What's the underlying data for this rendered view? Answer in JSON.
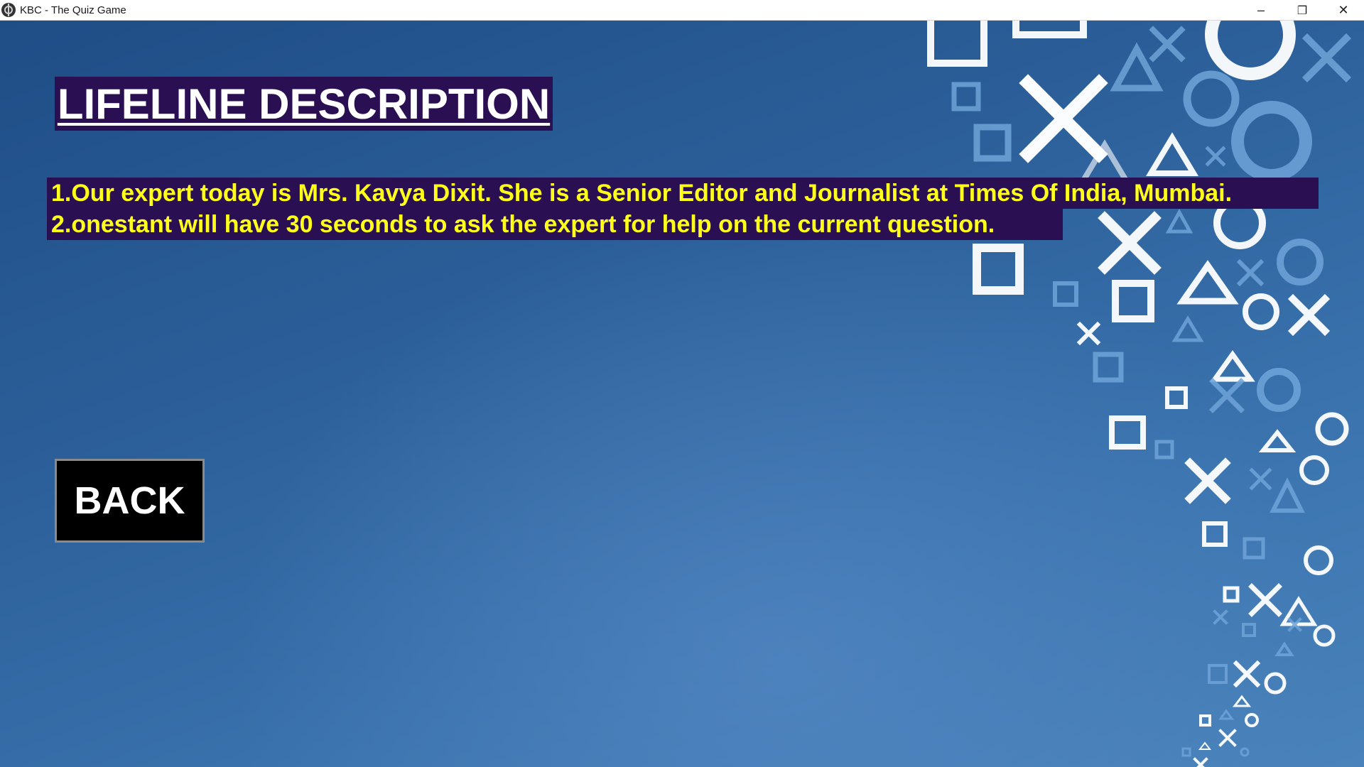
{
  "window": {
    "title": "KBC - The Quiz Game",
    "controls": {
      "minimize": "–",
      "restore": "❐",
      "close": "✕"
    }
  },
  "heading": {
    "text": "LIFELINE DESCRIPTION"
  },
  "description": {
    "lines": [
      "1.Our expert today is Mrs. Kavya Dixit. She is a Senior Editor and Journalist at Times Of India, Mumbai.",
      "2.onestant will have 30 seconds to ask the expert for help on the current question."
    ]
  },
  "back_button": {
    "label": "BACK"
  },
  "colors": {
    "heading_bg": "#2a0f52",
    "description_text": "#ffff1a",
    "background": "#2d5b92"
  },
  "icons": [
    "app-icon",
    "minimize-icon",
    "restore-icon",
    "close-icon"
  ]
}
